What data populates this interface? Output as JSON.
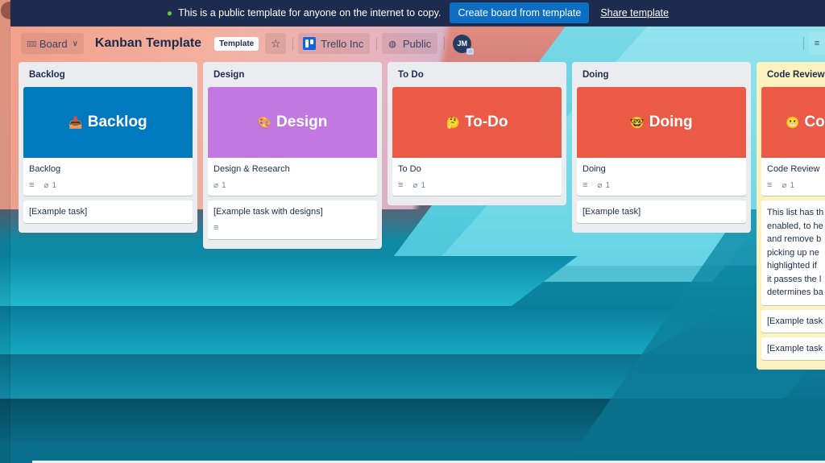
{
  "banner": {
    "message": "This is a public template for anyone on the internet to copy.",
    "globe_icon": "globe-icon",
    "create_button": "Create board from template",
    "share_link": "Share template"
  },
  "header": {
    "view_label": "Board",
    "board_title": "Kanban Template",
    "template_badge": "Template",
    "workspace": "Trello Inc",
    "visibility": "Public",
    "avatar_initials": "JM",
    "icons": {
      "view": "board-view-icon",
      "chevron": "chevron-down-icon",
      "star": "star-icon",
      "workspace": "trello-logo-icon",
      "visibility": "globe-icon",
      "filter": "filter-icon"
    }
  },
  "glyphs": {
    "star": "☆",
    "chevron": "⌄",
    "globe": "◍",
    "sidebar": "›",
    "board_view": "▯▯▯",
    "filter": "≡",
    "description": "≡",
    "attachment": "📎"
  },
  "lists": [
    {
      "title": "Backlog",
      "cover_color": "#0079bf",
      "cover_emoji": "📥",
      "cover_text": "Backlog",
      "cards": [
        {
          "title": "Backlog",
          "has_description": true,
          "attachments": "1"
        },
        {
          "title": "[Example task]"
        }
      ]
    },
    {
      "title": "Design",
      "cover_color": "#c377e0",
      "cover_emoji": "🎨",
      "cover_text": "Design",
      "cards": [
        {
          "title": "Design & Research",
          "has_description": false,
          "attachments": "1"
        },
        {
          "title": "[Example task with designs]",
          "has_description": true
        }
      ]
    },
    {
      "title": "To Do",
      "cover_color": "#eb5a46",
      "cover_emoji": "🤔",
      "cover_text": "To-Do",
      "cards": [
        {
          "title": "To Do",
          "has_description": true,
          "attachments": "1"
        }
      ]
    },
    {
      "title": "Doing",
      "cover_color": "#eb5a46",
      "cover_emoji": "🤓",
      "cover_text": "Doing",
      "cards": [
        {
          "title": "Doing",
          "has_description": true,
          "attachments": "1"
        },
        {
          "title": "[Example task]"
        }
      ]
    },
    {
      "title": "Code Review",
      "list_color": "#fbf2c0",
      "cover_color": "#eb5a46",
      "cover_emoji": "😬",
      "cover_text": "Co",
      "cards": [
        {
          "title": "Code Review",
          "has_description": true,
          "attachments": "1"
        },
        {
          "lines": [
            "This list has th",
            "enabled, to he",
            "and remove b",
            "picking up ne",
            "highlighted if",
            "it passes the l",
            "determines ba"
          ]
        },
        {
          "title": "[Example task"
        },
        {
          "title": "[Example task"
        }
      ]
    }
  ]
}
